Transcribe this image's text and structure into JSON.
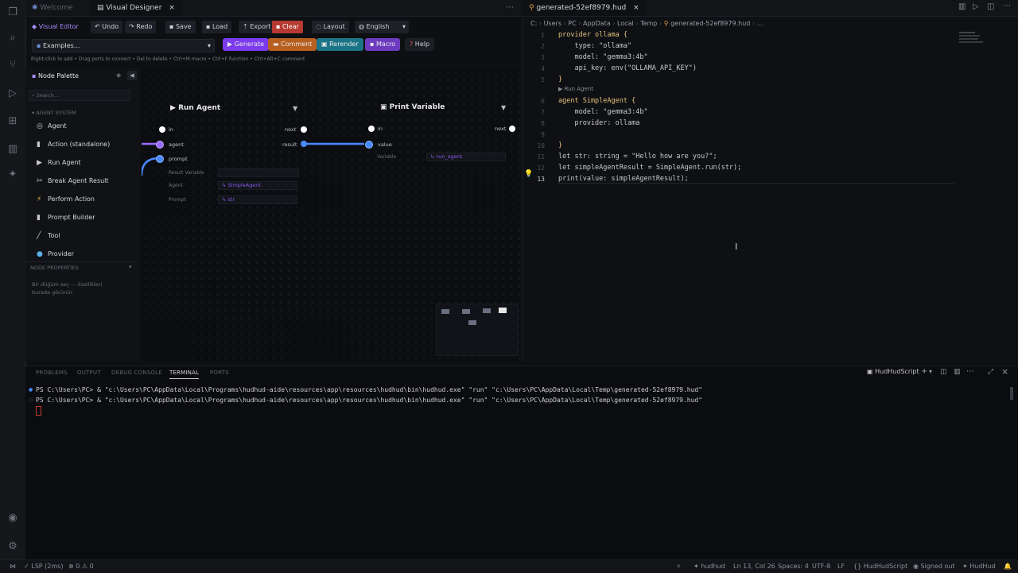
{
  "tabs": {
    "welcome": "Welcome",
    "visual_designer": "Visual Designer",
    "editor_file": "generated-52ef8979.hud"
  },
  "toolbar": {
    "brand": "Visual Editor",
    "undo": "Undo",
    "redo": "Redo",
    "save": "Save",
    "load": "Load",
    "export": "Export",
    "clear": "Clear",
    "layout": "Layout",
    "language": "English",
    "examples": "Examples...",
    "generate": "Generate",
    "comment": "Comment",
    "rerender": "Rerender",
    "macro": "Macro",
    "help": "Help",
    "hint": "Right-click to add • Drag ports to connect • Del to delete • Ctrl+M macro • Ctrl+F function • Ctrl+Alt+C comment"
  },
  "palette": {
    "title": "Node Palette",
    "search_placeholder": "Search...",
    "section": "AGENT SYSTEM",
    "items": [
      "Agent",
      "Action (standalone)",
      "Run Agent",
      "Break Agent Result",
      "Perform Action",
      "Prompt Builder",
      "Tool",
      "Provider"
    ],
    "props_title": "NODE PROPERTIES",
    "props_empty": "Bir düğüm seç — özellikleri burada görünür."
  },
  "nodes": {
    "run_agent": {
      "title": "Run Agent",
      "in": "in",
      "next": "next",
      "agent": "agent",
      "prompt": "prompt",
      "result": "result",
      "result_var_label": "Result Variable",
      "agent_label": "Agent",
      "agent_value": "SimpleAgent",
      "prompt_label": "Prompt",
      "prompt_value": "str"
    },
    "print_variable": {
      "title": "Print Variable",
      "in": "in",
      "next": "next",
      "value": "value",
      "variable_label": "Variable",
      "variable_value": "run_agent"
    }
  },
  "editor": {
    "breadcrumb": [
      "C:",
      "Users",
      "PC",
      "AppData",
      "Local",
      "Temp",
      "generated-52ef8979.hud",
      "..."
    ],
    "codelens": "Run Agent",
    "lines": [
      {
        "n": "1",
        "t": "provider ollama {"
      },
      {
        "n": "2",
        "t": "    type: \"ollama\""
      },
      {
        "n": "3",
        "t": "    model: \"gemma3:4b\""
      },
      {
        "n": "4",
        "t": "    api_key: env(\"OLLAMA_API_KEY\")"
      },
      {
        "n": "5",
        "t": "}"
      },
      {
        "n": "6",
        "t": "agent SimpleAgent {"
      },
      {
        "n": "7",
        "t": "    model: \"gemma3:4b\""
      },
      {
        "n": "8",
        "t": "    provider: ollama"
      },
      {
        "n": "9",
        "t": ""
      },
      {
        "n": "10",
        "t": "}"
      },
      {
        "n": "11",
        "t": "let str: string = \"Hello how are you?\";"
      },
      {
        "n": "12",
        "t": "let simpleAgentResult = SimpleAgent.run(str);"
      },
      {
        "n": "13",
        "t": "print(value: simpleAgentResult);"
      }
    ]
  },
  "panel": {
    "tabs": [
      "PROBLEMS",
      "OUTPUT",
      "DEBUG CONSOLE",
      "TERMINAL",
      "PORTS"
    ],
    "active_tab": "TERMINAL",
    "terminal_name": "HudHudScript",
    "lines": [
      "PS C:\\Users\\PC> & \"c:\\Users\\PC\\AppData\\Local\\Programs\\hudhud-aide\\resources\\app\\resources\\hudhud\\bin\\hudhud.exe\" \"run\" \"c:\\Users\\PC\\AppData\\Local\\Temp\\generated-52ef8979.hud\"",
      "PS C:\\Users\\PC> & \"c:\\Users\\PC\\AppData\\Local\\Programs\\hudhud-aide\\resources\\app\\resources\\hudhud\\bin\\hudhud.exe\" \"run\" \"c:\\Users\\PC\\AppData\\Local\\Temp\\generated-52ef8979.hud\""
    ]
  },
  "status": {
    "lsp": "LSP (2ms)",
    "problems": "0",
    "warnings": "0",
    "hudhud": "hudhud",
    "position": "Ln 13, Col 26",
    "spaces": "Spaces: 4",
    "encoding": "UTF-8",
    "eol": "LF",
    "language": "HudHudScript",
    "account": "Signed out",
    "brand": "HudHud"
  },
  "colors": {
    "accent_purple": "#8b5cf6",
    "clear_red": "#c0392b",
    "comment_orange": "#c96a1e",
    "rerender_teal": "#1e7a8a",
    "port_purple": "#9b6bff",
    "port_blue": "#4a88ff"
  }
}
